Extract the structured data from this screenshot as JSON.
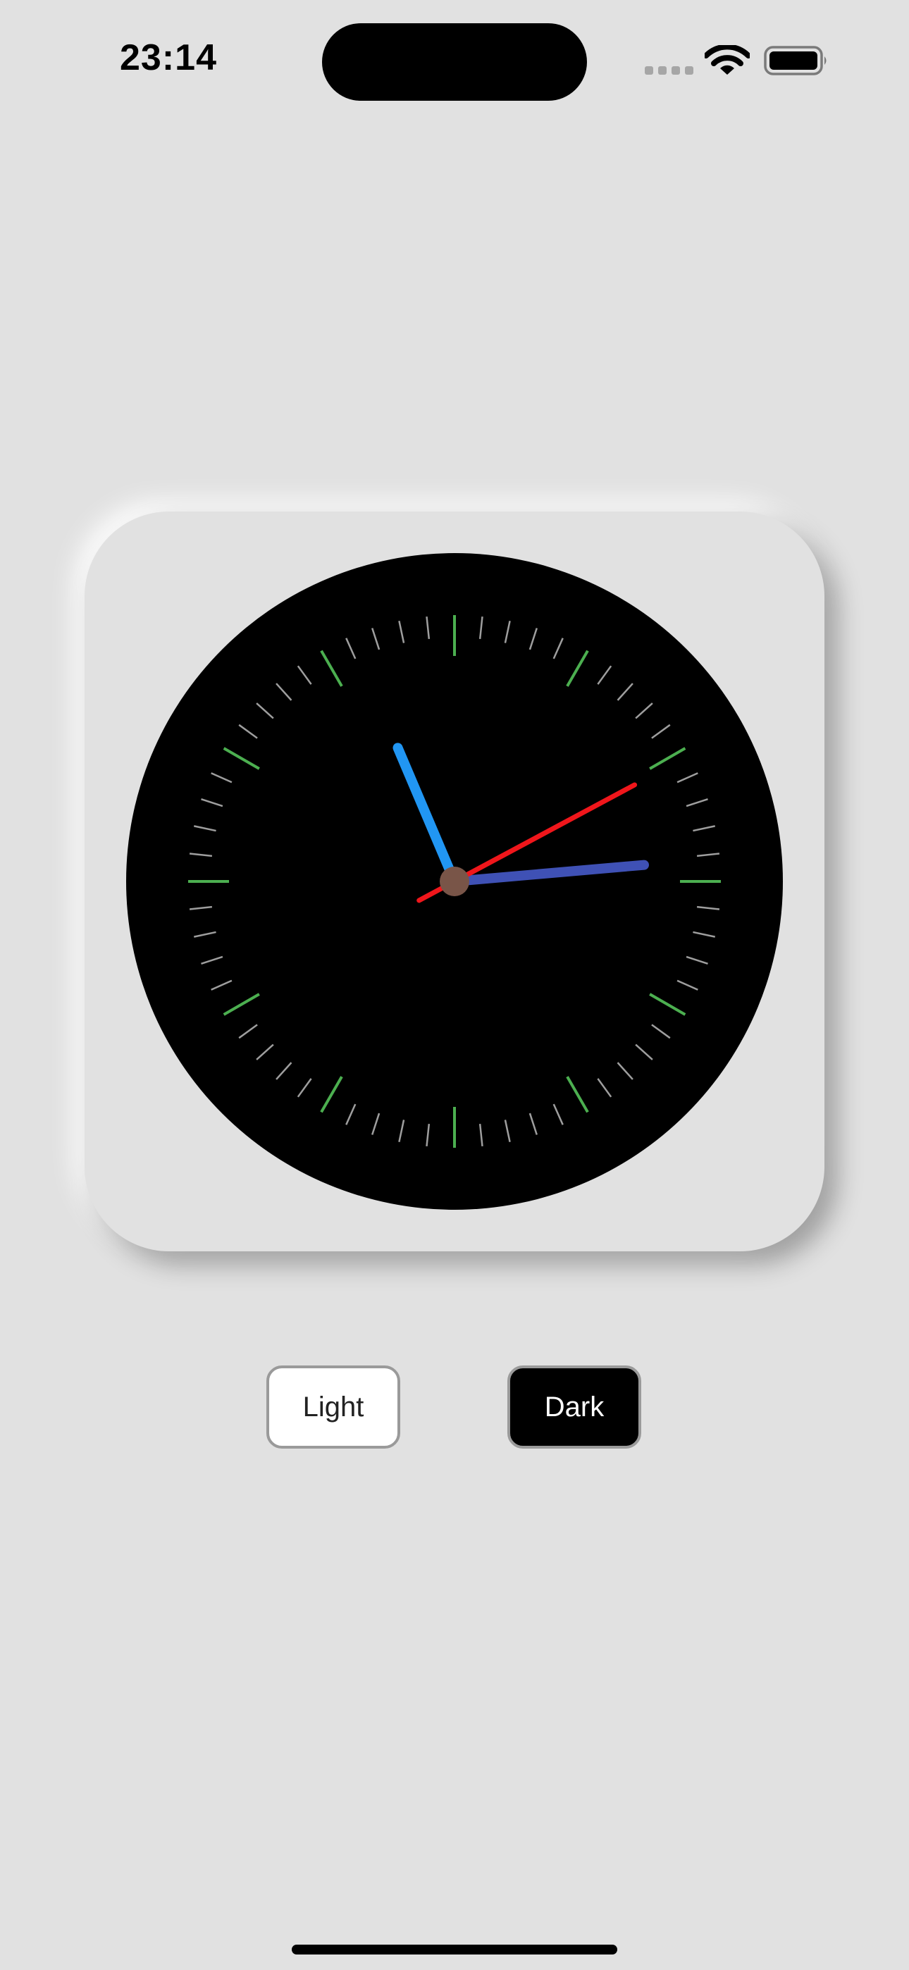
{
  "status_bar": {
    "time": "23:14",
    "signal_icon": "cellular-signal-icon",
    "wifi_icon": "wifi-icon",
    "battery_icon": "battery-icon"
  },
  "clock": {
    "time": {
      "hour": 23,
      "minute": 14,
      "second": 10.3
    },
    "face_color": "#000000",
    "hour_marker_color": "#4caf50",
    "minute_marker_color": "#9e9e9e",
    "hour_hand_color": "#2196f3",
    "minute_hand_color": "#3f51b5",
    "second_hand_color": "#f0161b",
    "center_dot_color": "#795548"
  },
  "theme_buttons": {
    "light_label": "Light",
    "dark_label": "Dark"
  }
}
